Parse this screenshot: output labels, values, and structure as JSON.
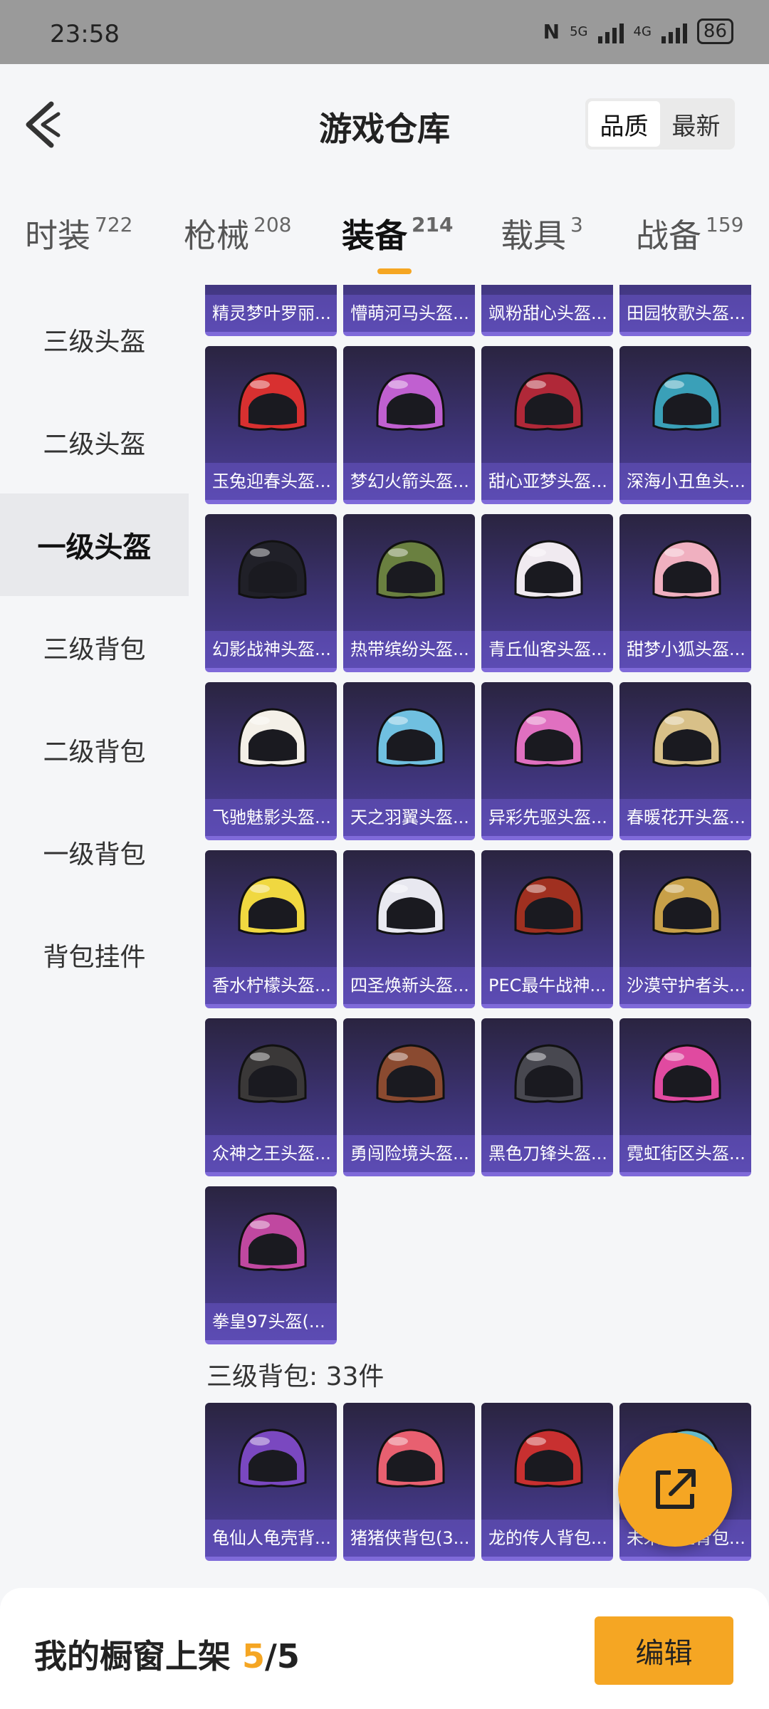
{
  "status_bar": {
    "time": "23:58",
    "network_5g": "5G",
    "network_4g": "4G",
    "battery": "86"
  },
  "header": {
    "title": "游戏仓库",
    "sort_options": [
      "品质",
      "最新"
    ],
    "sort_active": "品质"
  },
  "tabs": [
    {
      "label": "时装",
      "count": "722"
    },
    {
      "label": "枪械",
      "count": "208"
    },
    {
      "label": "装备",
      "count": "214",
      "active": true
    },
    {
      "label": "载具",
      "count": "3"
    },
    {
      "label": "战备",
      "count": "159"
    }
  ],
  "sidebar": [
    {
      "label": "三级头盔"
    },
    {
      "label": "二级头盔"
    },
    {
      "label": "一级头盔",
      "active": true
    },
    {
      "label": "三级背包"
    },
    {
      "label": "二级背包"
    },
    {
      "label": "一级背包"
    },
    {
      "label": "背包挂件"
    }
  ],
  "items": [
    {
      "name": "精灵梦叶罗丽...",
      "color": "#e8d0e0"
    },
    {
      "name": "懵萌河马头盔...",
      "color": "#b8b0d8"
    },
    {
      "name": "飒粉甜心头盔...",
      "color": "#e8b8d0"
    },
    {
      "name": "田园牧歌头盔...",
      "color": "#d8c8a0"
    },
    {
      "name": "玉兔迎春头盔...",
      "color": "#d83030"
    },
    {
      "name": "梦幻火箭头盔...",
      "color": "#c060d0"
    },
    {
      "name": "甜心亚梦头盔...",
      "color": "#b02838"
    },
    {
      "name": "深海小丑鱼头...",
      "color": "#3aa0b8"
    },
    {
      "name": "幻影战神头盔...",
      "color": "#202028"
    },
    {
      "name": "热带缤纷头盔...",
      "color": "#6a8040"
    },
    {
      "name": "青丘仙客头盔...",
      "color": "#f0eaf0"
    },
    {
      "name": "甜梦小狐头盔...",
      "color": "#f0b0c0"
    },
    {
      "name": "飞驰魅影头盔...",
      "color": "#f4f0e8"
    },
    {
      "name": "天之羽翼头盔...",
      "color": "#70c0e0"
    },
    {
      "name": "异彩先驱头盔...",
      "color": "#e070c0"
    },
    {
      "name": "春暖花开头盔...",
      "color": "#d8c088"
    },
    {
      "name": "香水柠檬头盔...",
      "color": "#f0d840"
    },
    {
      "name": "四圣焕新头盔...",
      "color": "#e8e8f0"
    },
    {
      "name": "PEC最牛战神...",
      "color": "#a03020"
    },
    {
      "name": "沙漠守护者头...",
      "color": "#c8a048"
    },
    {
      "name": "众神之王头盔...",
      "color": "#3a3838"
    },
    {
      "name": "勇闯险境头盔...",
      "color": "#8a4a30"
    },
    {
      "name": "黑色刀锋头盔...",
      "color": "#484850"
    },
    {
      "name": "霓虹街区头盔...",
      "color": "#e04aa0"
    },
    {
      "name": "拳皇97头盔(...",
      "color": "#c048a0"
    }
  ],
  "section2": {
    "title": "三级背包: 33件"
  },
  "items2": [
    {
      "name": "龟仙人龟壳背...",
      "color": "#7a48c0"
    },
    {
      "name": "猪猪侠背包(3...",
      "color": "#e86070"
    },
    {
      "name": "龙的传人背包...",
      "color": "#c83030"
    },
    {
      "name": "未来歌姬背包...",
      "color": "#6ac0d0"
    }
  ],
  "bottom": {
    "label": "我的橱窗上架 ",
    "count": "5",
    "total": "/5",
    "edit": "编辑"
  },
  "accent": "#f5a623"
}
